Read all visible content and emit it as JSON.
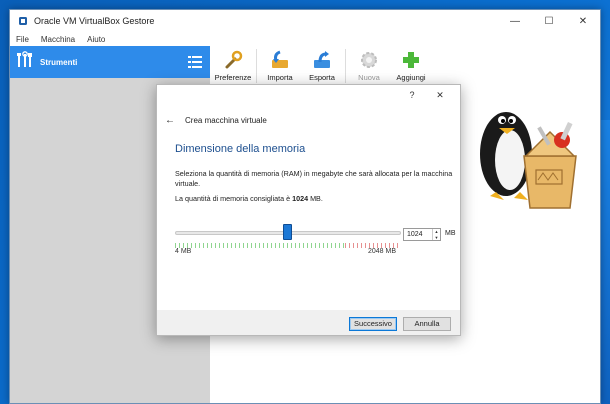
{
  "window": {
    "title": "Oracle VM VirtualBox Gestore",
    "minimize": "—",
    "maximize": "☐",
    "close": "✕"
  },
  "menu": [
    "File",
    "Macchina",
    "Aiuto"
  ],
  "sidebar": {
    "tools_label": "Strumenti"
  },
  "toolbar": [
    {
      "label": "Preferenze",
      "icon": "wrench-icon",
      "enabled": true
    },
    {
      "label": "Importa",
      "icon": "import-icon",
      "enabled": true
    },
    {
      "label": "Esporta",
      "icon": "export-icon",
      "enabled": true
    },
    {
      "label": "Nuova",
      "icon": "new-gear-icon",
      "enabled": false
    },
    {
      "label": "Aggiungi",
      "icon": "add-icon",
      "enabled": true
    }
  ],
  "dialog": {
    "help": "?",
    "close": "✕",
    "back": "←",
    "header": "Crea macchina virtuale",
    "section_title": "Dimensione della memoria",
    "description": "Seleziona la quantità di memoria (RAM) in megabyte che sarà allocata per la macchina virtuale.",
    "recommended_prefix": "La quantità di memoria consigliata è ",
    "recommended_value": "1024",
    "recommended_suffix": " MB.",
    "memory": {
      "value": "1024",
      "min_label": "4 MB",
      "max_label": "2048 MB",
      "unit": "MB",
      "min": 4,
      "max": 2048,
      "current": 1024,
      "safe_fraction": 0.75
    },
    "next_button": "Successivo",
    "cancel_button": "Annulla"
  },
  "colors": {
    "accent": "#2e8bea",
    "title": "#1d4f8f",
    "thumb": "#1c78d6"
  }
}
